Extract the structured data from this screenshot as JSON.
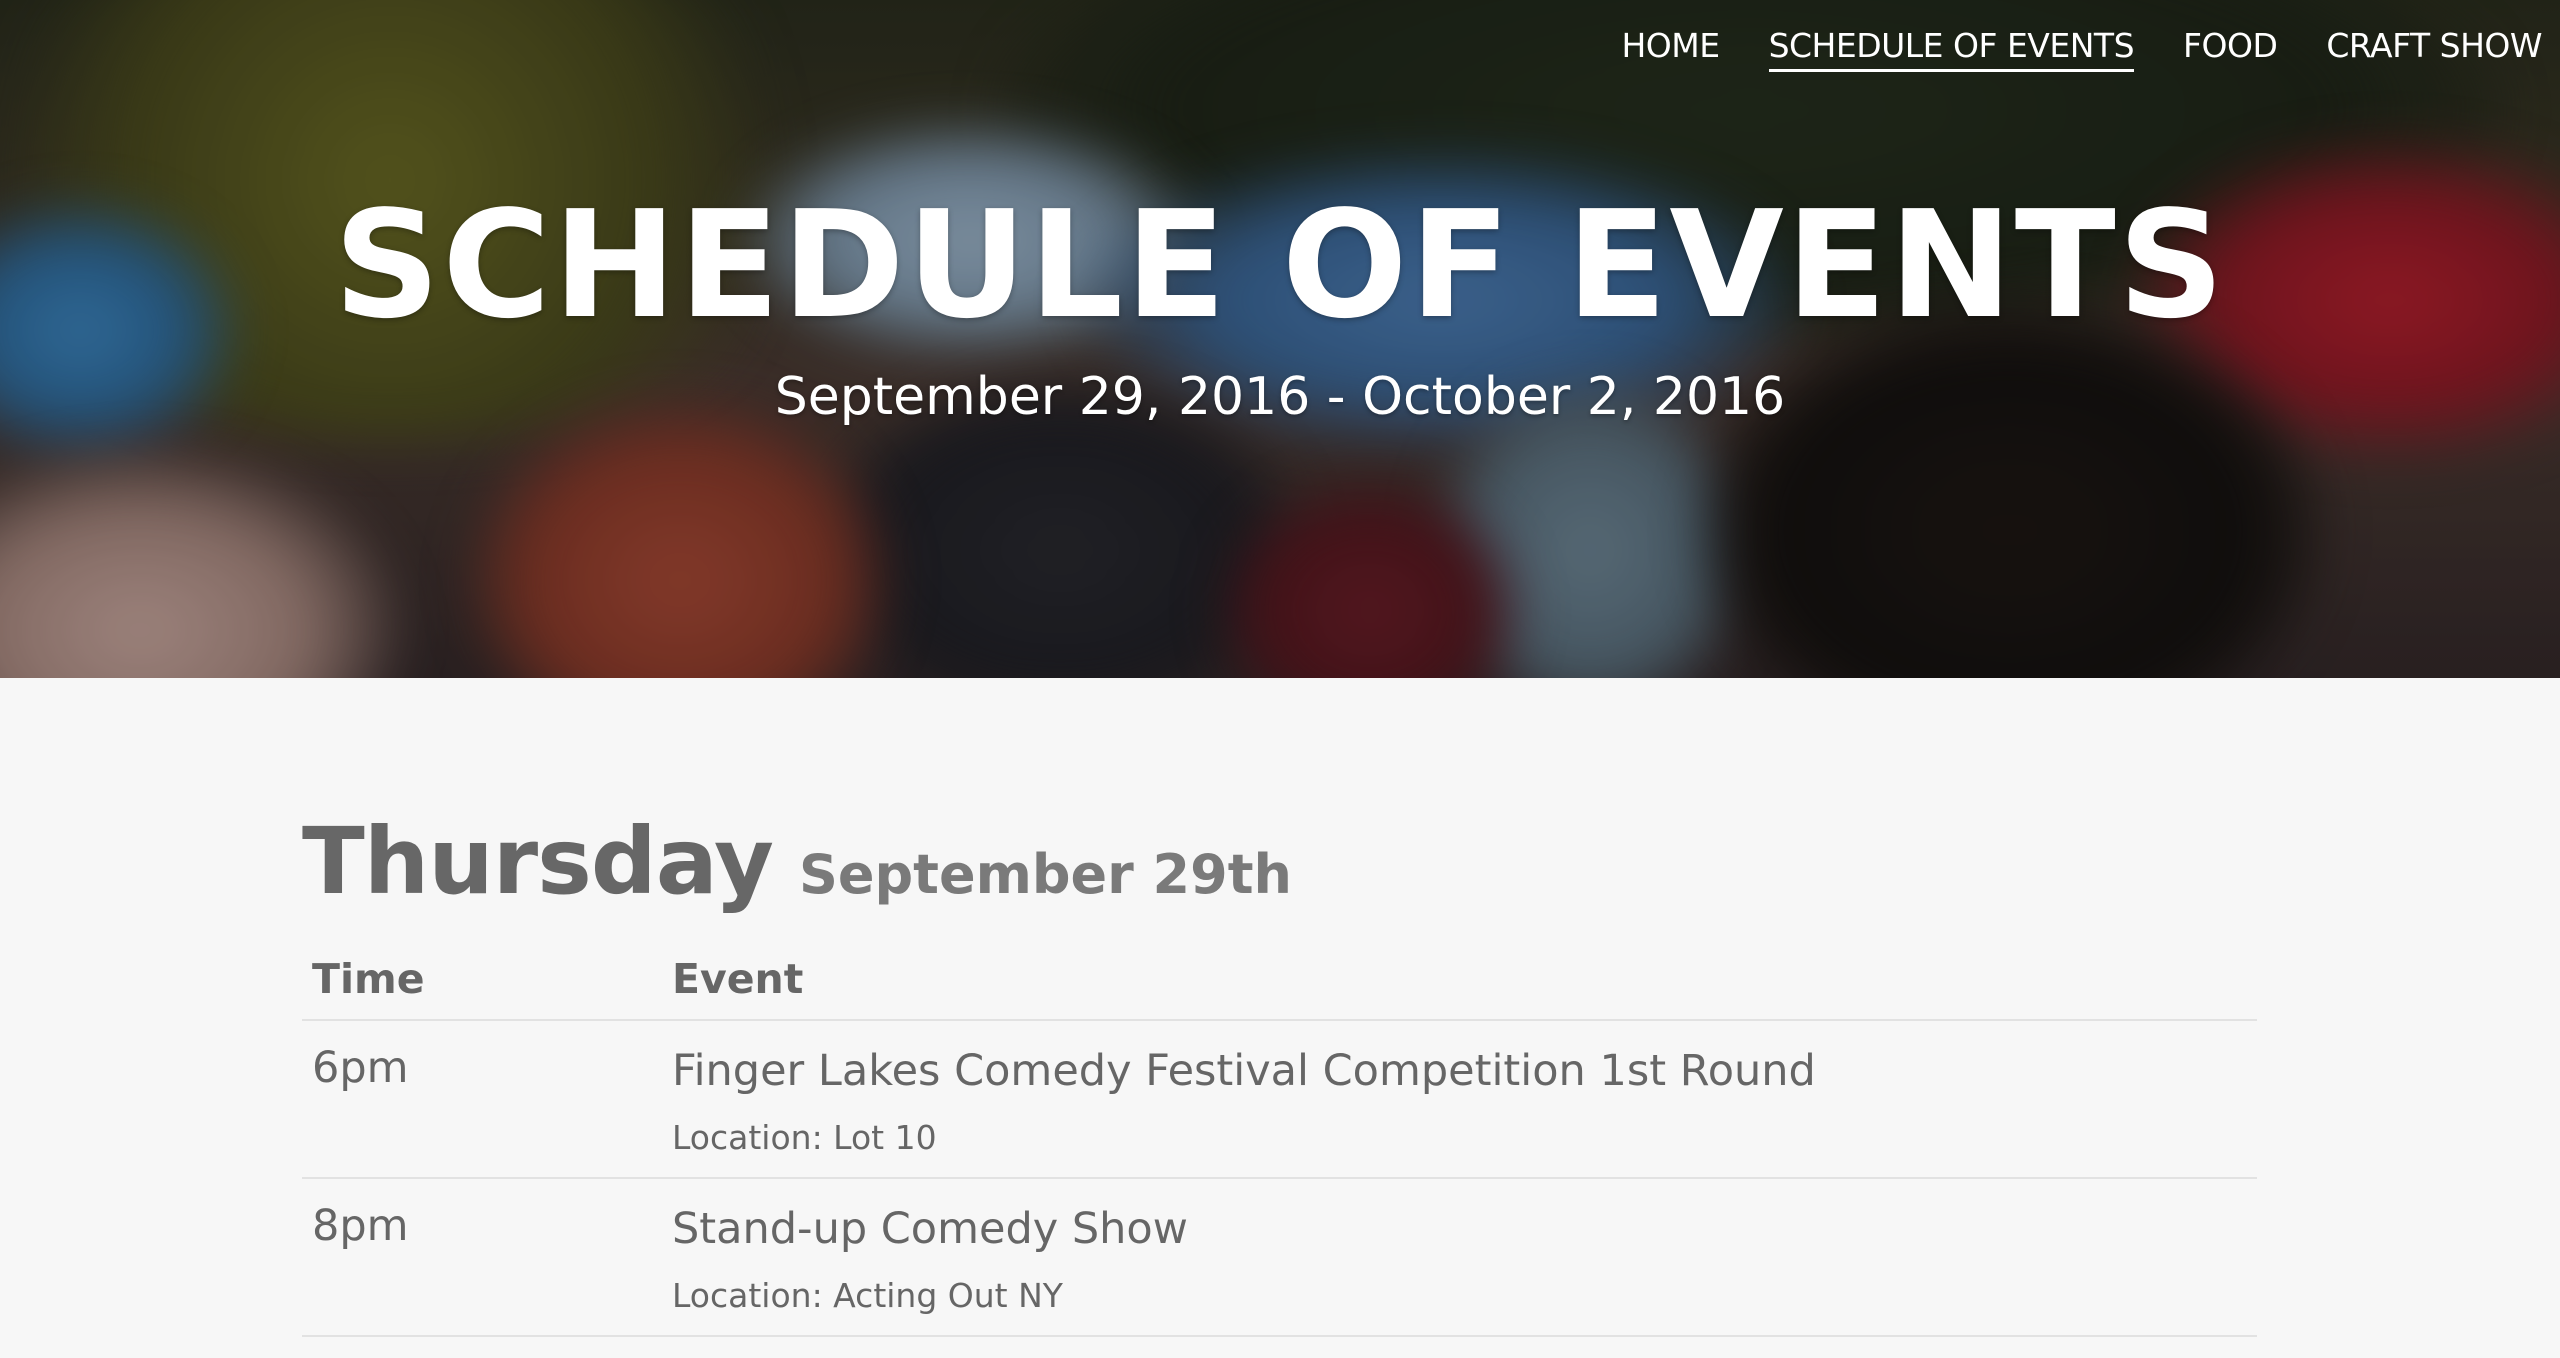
{
  "nav": {
    "items": [
      {
        "label": "HOME",
        "active": false
      },
      {
        "label": "SCHEDULE OF EVENTS",
        "active": true
      },
      {
        "label": "FOOD",
        "active": false
      },
      {
        "label": "CRAFT SHOW",
        "active": false
      }
    ]
  },
  "hero": {
    "title": "SCHEDULE OF EVENTS",
    "subtitle": "September 29, 2016 - October 2, 2016"
  },
  "schedule": {
    "day": {
      "name": "Thursday",
      "date": "September 29th"
    },
    "columns": [
      "Time",
      "Event"
    ],
    "rows": [
      {
        "time": "6pm",
        "event": "Finger Lakes Comedy Festival Competition 1st Round",
        "location": "Location: Lot 10"
      },
      {
        "time": "8pm",
        "event": "Stand-up Comedy Show",
        "location": "Location: Acting Out NY"
      }
    ]
  },
  "colors": {
    "page_background": "#f7f7f7",
    "text": "#666666",
    "hero_text": "#ffffff",
    "divider": "#e2e2e2"
  }
}
